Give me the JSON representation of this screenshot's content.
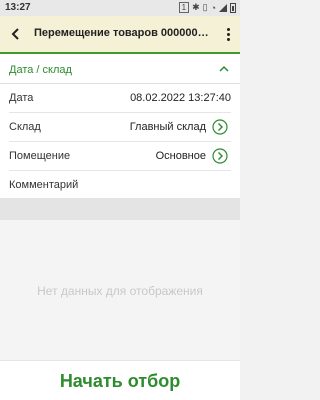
{
  "status_bar": {
    "time": "13:27",
    "sim_label": "1",
    "icons": [
      "sim-icon",
      "bluetooth-icon",
      "vibrate-icon",
      "alarm-icon",
      "signal-icon",
      "battery-icon"
    ]
  },
  "toolbar": {
    "title": "Перемещение товаров 000000…",
    "back_icon": "chevron-left-icon",
    "menu_icon": "more-vertical-icon"
  },
  "section": {
    "title": "Дата / склад",
    "collapse_icon": "chevron-up-icon"
  },
  "fields": {
    "date": {
      "label": "Дата",
      "value": "08.02.2022 13:27:40"
    },
    "warehouse": {
      "label": "Склад",
      "value": "Главный склад"
    },
    "room": {
      "label": "Помещение",
      "value": "Основное"
    },
    "comment": {
      "label": "Комментарий",
      "value": ""
    }
  },
  "empty_state": {
    "text": "Нет данных для отображения"
  },
  "actions": {
    "start_label": "Начать отбор"
  },
  "colors": {
    "accent": "#2e8b2e",
    "toolbar_bg": "#f4f1d6"
  }
}
